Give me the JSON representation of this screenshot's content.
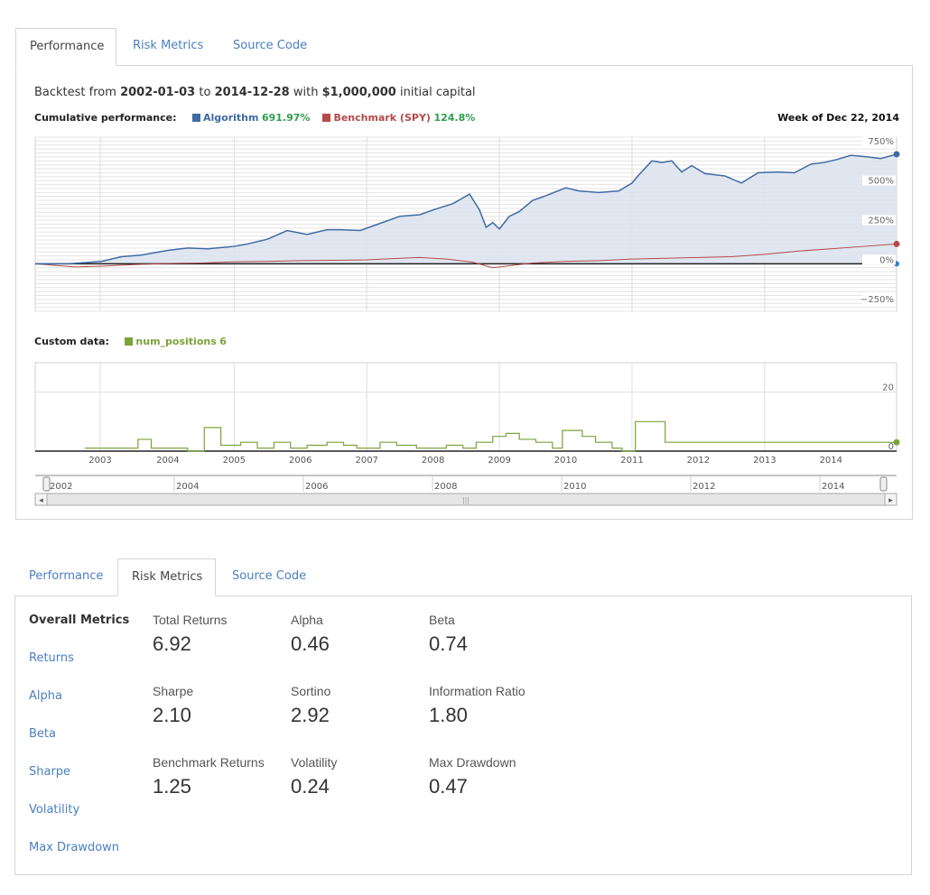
{
  "tabs_top": [
    "Performance",
    "Risk Metrics",
    "Source Code"
  ],
  "summary": {
    "prefix": "Backtest from",
    "start": "2002-01-03",
    "to": "to",
    "end": "2014-12-28",
    "with": "with",
    "capital": "$1,000,000",
    "suffix": "initial capital"
  },
  "legend": {
    "label": "Cumulative performance:",
    "algorithm_name": "Algorithm",
    "algorithm_value": "691.97%",
    "benchmark_name": "Benchmark (SPY)",
    "benchmark_value": "124.8%",
    "week": "Week of Dec 22, 2014"
  },
  "custom": {
    "label": "Custom data:",
    "series_name": "num_positions",
    "series_value": "6"
  },
  "colors": {
    "algorithm": "#3f6aa5",
    "benchmark": "#b44a4a",
    "num_positions": "#7aa33a",
    "link": "#4a7fc1",
    "positive": "#2e9d4e"
  },
  "chart_data": [
    {
      "type": "area",
      "ylim": [
        -300,
        800
      ],
      "yticks": [
        "750%",
        "500%",
        "250%",
        "0%",
        "−250%"
      ],
      "ytick_values": [
        750,
        500,
        250,
        0,
        -250
      ],
      "x_range": [
        2002.0,
        2014.99
      ],
      "series": [
        {
          "name": "Algorithm",
          "x": [
            2002.0,
            2002.5,
            2003.0,
            2003.3,
            2003.6,
            2004.0,
            2004.3,
            2004.6,
            2005.0,
            2005.2,
            2005.5,
            2005.8,
            2006.1,
            2006.4,
            2006.6,
            2006.9,
            2007.2,
            2007.5,
            2007.8,
            2008.0,
            2008.3,
            2008.55,
            2008.7,
            2008.8,
            2008.9,
            2009.0,
            2009.15,
            2009.3,
            2009.5,
            2009.7,
            2010.0,
            2010.2,
            2010.5,
            2010.8,
            2011.0,
            2011.1,
            2011.3,
            2011.45,
            2011.6,
            2011.75,
            2011.9,
            2012.1,
            2012.4,
            2012.65,
            2012.9,
            2013.2,
            2013.45,
            2013.7,
            2013.9,
            2014.1,
            2014.3,
            2014.55,
            2014.75,
            2014.99
          ],
          "values": [
            0,
            0,
            15,
            45,
            55,
            85,
            100,
            95,
            110,
            125,
            155,
            210,
            185,
            215,
            215,
            210,
            255,
            300,
            310,
            340,
            380,
            440,
            340,
            230,
            260,
            220,
            300,
            330,
            400,
            430,
            480,
            460,
            450,
            460,
            510,
            560,
            650,
            640,
            650,
            580,
            620,
            570,
            555,
            510,
            575,
            580,
            575,
            630,
            640,
            660,
            685,
            675,
            665,
            692
          ]
        },
        {
          "name": "Benchmark (SPY)",
          "x": [
            2002.0,
            2002.3,
            2002.6,
            2003.0,
            2003.5,
            2004.0,
            2004.5,
            2005.0,
            2005.5,
            2006.0,
            2006.5,
            2007.0,
            2007.5,
            2007.8,
            2008.2,
            2008.6,
            2008.9,
            2009.2,
            2009.5,
            2010.0,
            2010.5,
            2011.0,
            2011.5,
            2012.0,
            2012.5,
            2013.0,
            2013.5,
            2014.0,
            2014.5,
            2014.99
          ],
          "values": [
            0,
            -10,
            -20,
            -15,
            -5,
            2,
            5,
            12,
            15,
            20,
            22,
            25,
            35,
            40,
            30,
            10,
            -25,
            -10,
            5,
            15,
            20,
            30,
            35,
            40,
            45,
            60,
            80,
            95,
            110,
            125
          ]
        }
      ]
    },
    {
      "type": "line",
      "ylim": [
        0,
        30
      ],
      "yticks": [
        "20",
        "0"
      ],
      "ytick_values": [
        20,
        0
      ],
      "x_range": [
        2002.0,
        2014.99
      ],
      "xticks": [
        "2003",
        "2004",
        "2005",
        "2006",
        "2007",
        "2008",
        "2009",
        "2010",
        "2011",
        "2012",
        "2013",
        "2014"
      ],
      "series": [
        {
          "name": "num_positions",
          "x": [
            2002.75,
            2003.3,
            2003.55,
            2003.75,
            2004.3,
            2004.55,
            2004.8,
            2005.1,
            2005.35,
            2005.6,
            2005.85,
            2006.1,
            2006.4,
            2006.65,
            2006.85,
            2007.2,
            2007.45,
            2007.75,
            2008.2,
            2008.45,
            2008.65,
            2008.9,
            2009.1,
            2009.3,
            2009.55,
            2009.8,
            2009.95,
            2010.25,
            2010.45,
            2010.7,
            2010.85,
            2011.05,
            2011.25,
            2011.5,
            2014.99
          ],
          "values": [
            1,
            1,
            4,
            1,
            0,
            8,
            2,
            3,
            1,
            3,
            1,
            2,
            3,
            2,
            1,
            3,
            2,
            1,
            2,
            1,
            3,
            5,
            6,
            4,
            3,
            1,
            7,
            5,
            3,
            1,
            0,
            10,
            10,
            3,
            3
          ]
        }
      ]
    }
  ],
  "navigator": {
    "labels": [
      "2002",
      "2004",
      "2006",
      "2008",
      "2010",
      "2012",
      "2014"
    ],
    "scroll_left": "◂",
    "scroll_right": "▸",
    "grip": "|||"
  },
  "tabs_bottom": [
    "Performance",
    "Risk Metrics",
    "Source Code"
  ],
  "sidebar": [
    "Overall Metrics",
    "Returns",
    "Alpha",
    "Beta",
    "Sharpe",
    "Volatility",
    "Max Drawdown"
  ],
  "metrics": [
    {
      "label": "Total Returns",
      "value": "6.92"
    },
    {
      "label": "Alpha",
      "value": "0.46"
    },
    {
      "label": "Beta",
      "value": "0.74"
    },
    {
      "label": "Sharpe",
      "value": "2.10"
    },
    {
      "label": "Sortino",
      "value": "2.92"
    },
    {
      "label": "Information Ratio",
      "value": "1.80"
    },
    {
      "label": "Benchmark Returns",
      "value": "1.25"
    },
    {
      "label": "Volatility",
      "value": "0.24"
    },
    {
      "label": "Max Drawdown",
      "value": "0.47"
    }
  ]
}
